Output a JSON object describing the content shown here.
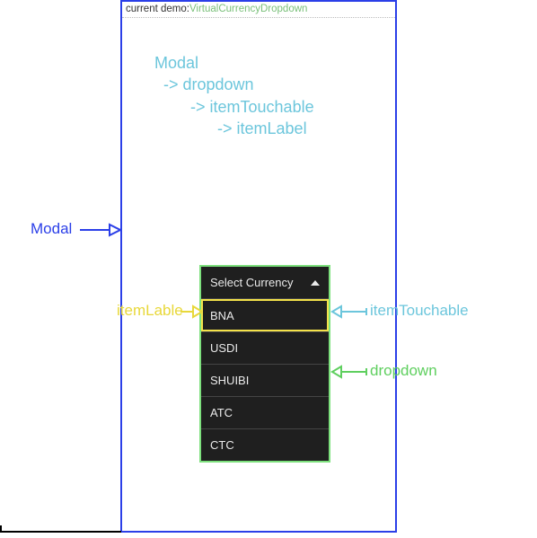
{
  "header": {
    "prefix": "current demo:",
    "name": "VirtualCurrencyDropdown"
  },
  "hierarchy": {
    "l1": "Modal",
    "l2": "  -> dropdown",
    "l3": "        -> itemTouchable",
    "l4": "              -> itemLabel"
  },
  "dropdown": {
    "title": "Select Currency",
    "items": [
      "BNA",
      "USDI",
      "SHUIBI",
      "ATC",
      "CTC"
    ]
  },
  "annotations": {
    "modal": "Modal",
    "itemLable": "itemLable",
    "itemTouchable": "itemTouchable",
    "dropdownLabel": "dropdown"
  },
  "colors": {
    "modalBorder": "#2b3fe8",
    "dropdownBorder": "#7de07d",
    "itemHighlight": "#f4e24a",
    "hierText": "#6cc6dc"
  }
}
